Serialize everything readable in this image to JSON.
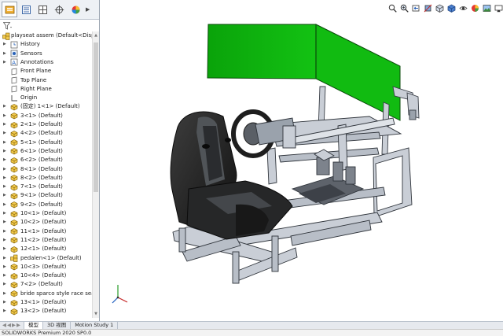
{
  "feature_tree": {
    "root_label": "playseat assem  (Default<Display",
    "items": [
      {
        "label": "History",
        "icon": "history-icon",
        "expandable": true
      },
      {
        "label": "Sensors",
        "icon": "sensors-icon",
        "expandable": true
      },
      {
        "label": "Annotations",
        "icon": "annotations-icon",
        "expandable": true
      },
      {
        "label": "Front Plane",
        "icon": "plane-icon",
        "expandable": false
      },
      {
        "label": "Top Plane",
        "icon": "plane-icon",
        "expandable": false
      },
      {
        "label": "Right Plane",
        "icon": "plane-icon",
        "expandable": false
      },
      {
        "label": "Origin",
        "icon": "origin-icon",
        "expandable": false
      },
      {
        "label": "(固定) 1<1> (Default)",
        "icon": "part-icon",
        "expandable": true
      },
      {
        "label": "3<1> (Default)",
        "icon": "part-icon",
        "expandable": true
      },
      {
        "label": "2<1> (Default)",
        "icon": "part-icon",
        "expandable": true
      },
      {
        "label": "4<2> (Default)",
        "icon": "part-icon",
        "expandable": true
      },
      {
        "label": "5<1> (Default)",
        "icon": "part-icon",
        "expandable": true
      },
      {
        "label": "6<1> (Default)",
        "icon": "part-icon",
        "expandable": true
      },
      {
        "label": "6<2> (Default)",
        "icon": "part-icon",
        "expandable": true
      },
      {
        "label": "8<1> (Default)",
        "icon": "part-icon",
        "expandable": true
      },
      {
        "label": "8<2> (Default)",
        "icon": "part-icon",
        "expandable": true
      },
      {
        "label": "7<1> (Default)",
        "icon": "part-icon",
        "expandable": true
      },
      {
        "label": "9<1> (Default)",
        "icon": "part-icon",
        "expandable": true
      },
      {
        "label": "9<2> (Default)",
        "icon": "part-icon",
        "expandable": true
      },
      {
        "label": "10<1> (Default)",
        "icon": "part-icon",
        "expandable": true
      },
      {
        "label": "10<2> (Default)",
        "icon": "part-icon",
        "expandable": true
      },
      {
        "label": "11<1> (Default)",
        "icon": "part-icon",
        "expandable": true
      },
      {
        "label": "11<2> (Default)",
        "icon": "part-icon",
        "expandable": true
      },
      {
        "label": "12<1> (Default)",
        "icon": "part-icon",
        "expandable": true
      },
      {
        "label": "pedalen<1> (Default)",
        "icon": "subassembly-icon",
        "expandable": true
      },
      {
        "label": "10<3> (Default)",
        "icon": "part-icon",
        "expandable": true
      },
      {
        "label": "10<4> (Default)",
        "icon": "part-icon",
        "expandable": true
      },
      {
        "label": "7<2> (Default)",
        "icon": "part-icon",
        "expandable": true
      },
      {
        "label": "bride sparco style race seat<",
        "icon": "part-icon",
        "expandable": true
      },
      {
        "label": "13<1> (Default)",
        "icon": "part-icon",
        "expandable": true
      },
      {
        "label": "13<2> (Default)",
        "icon": "part-icon",
        "expandable": true
      }
    ]
  },
  "bottom_tabs": {
    "nav": "◀◀▶▶",
    "tabs": [
      "模型",
      "3D 视图",
      "Motion Study 1"
    ],
    "active_index": 0
  },
  "status_bar": {
    "text": "SOLIDWORKS Premium 2020 SP0.0"
  },
  "colors": {
    "screen_green": "#0cad0c",
    "frame_silver": "#c9ced6",
    "seat_black": "#2a2a2a",
    "accent_blue": "#1f5fbf"
  }
}
